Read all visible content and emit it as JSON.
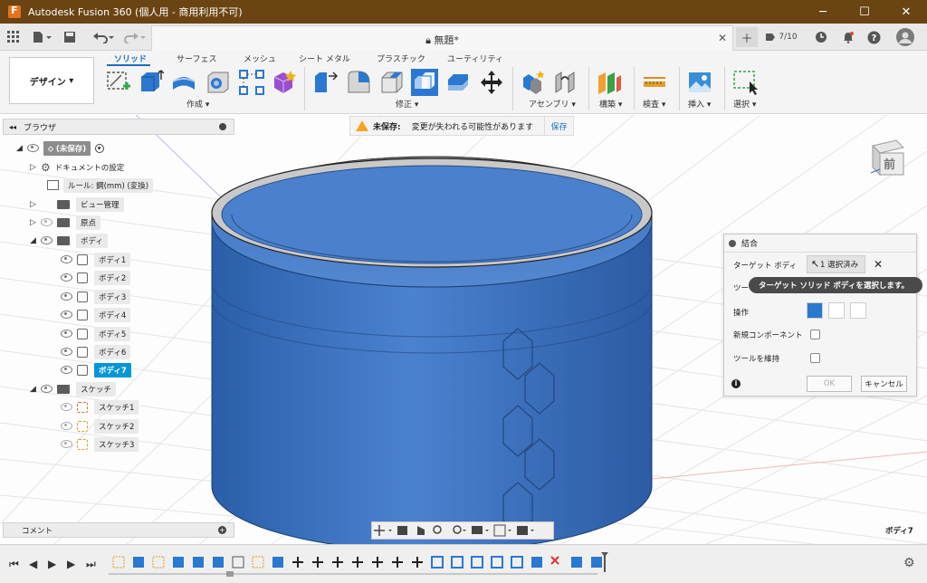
{
  "window": {
    "title": "Autodesk Fusion 360 (個人用 - 商用利用不可)",
    "buttons": [
      "─",
      "☐",
      "✕"
    ]
  },
  "quickbar": {
    "document_title": "無題*",
    "job_count": "7/10"
  },
  "ribbon": {
    "workspace": "デザイン",
    "tabs": [
      "ソリッド",
      "サーフェス",
      "メッシュ",
      "シート メタル",
      "プラスチック",
      "ユーティリティ"
    ],
    "active_tab": "ソリッド",
    "groups": [
      "作成",
      "修正",
      "アセンブリ",
      "構築",
      "検査",
      "挿入",
      "選択"
    ]
  },
  "browser": {
    "title": "ブラウザ",
    "root": "(未保存)",
    "nodes": [
      {
        "label": "ドキュメントの設定"
      },
      {
        "label": "ルール: 鋼(mm) (変換)"
      },
      {
        "label": "ビュー管理"
      },
      {
        "label": "原点"
      },
      {
        "label": "ボディ"
      },
      {
        "label": "ボディ1"
      },
      {
        "label": "ボディ2"
      },
      {
        "label": "ボディ3"
      },
      {
        "label": "ボディ4"
      },
      {
        "label": "ボディ5"
      },
      {
        "label": "ボディ6"
      },
      {
        "label": "ボディ7"
      },
      {
        "label": "スケッチ"
      },
      {
        "label": "スケッチ1"
      },
      {
        "label": "スケッチ2"
      },
      {
        "label": "スケッチ3"
      }
    ]
  },
  "warning": {
    "bold": "未保存:",
    "message": "変更が失われる可能性があります",
    "save": "保存"
  },
  "viewcube": {
    "face": "前"
  },
  "combine_dialog": {
    "title": "結合",
    "target_label": "ターゲット ボディ",
    "target_value": "1 選択済み",
    "tool_label": "ツー",
    "operation_label": "操作",
    "new_component_label": "新規コンポーネント",
    "keep_tools_label": "ツールを維持",
    "ok": "OK",
    "cancel": "キャンセル",
    "tooltip": "ターゲット ソリッド ボディを選択します。"
  },
  "comments": {
    "label": "コメント"
  },
  "status": {
    "selection": "ボディ7"
  },
  "colors": {
    "titlebar": "#6a4412",
    "accent": "#1b6ec2",
    "body_blue": "#3f74c4",
    "selection": "#0696d7"
  }
}
